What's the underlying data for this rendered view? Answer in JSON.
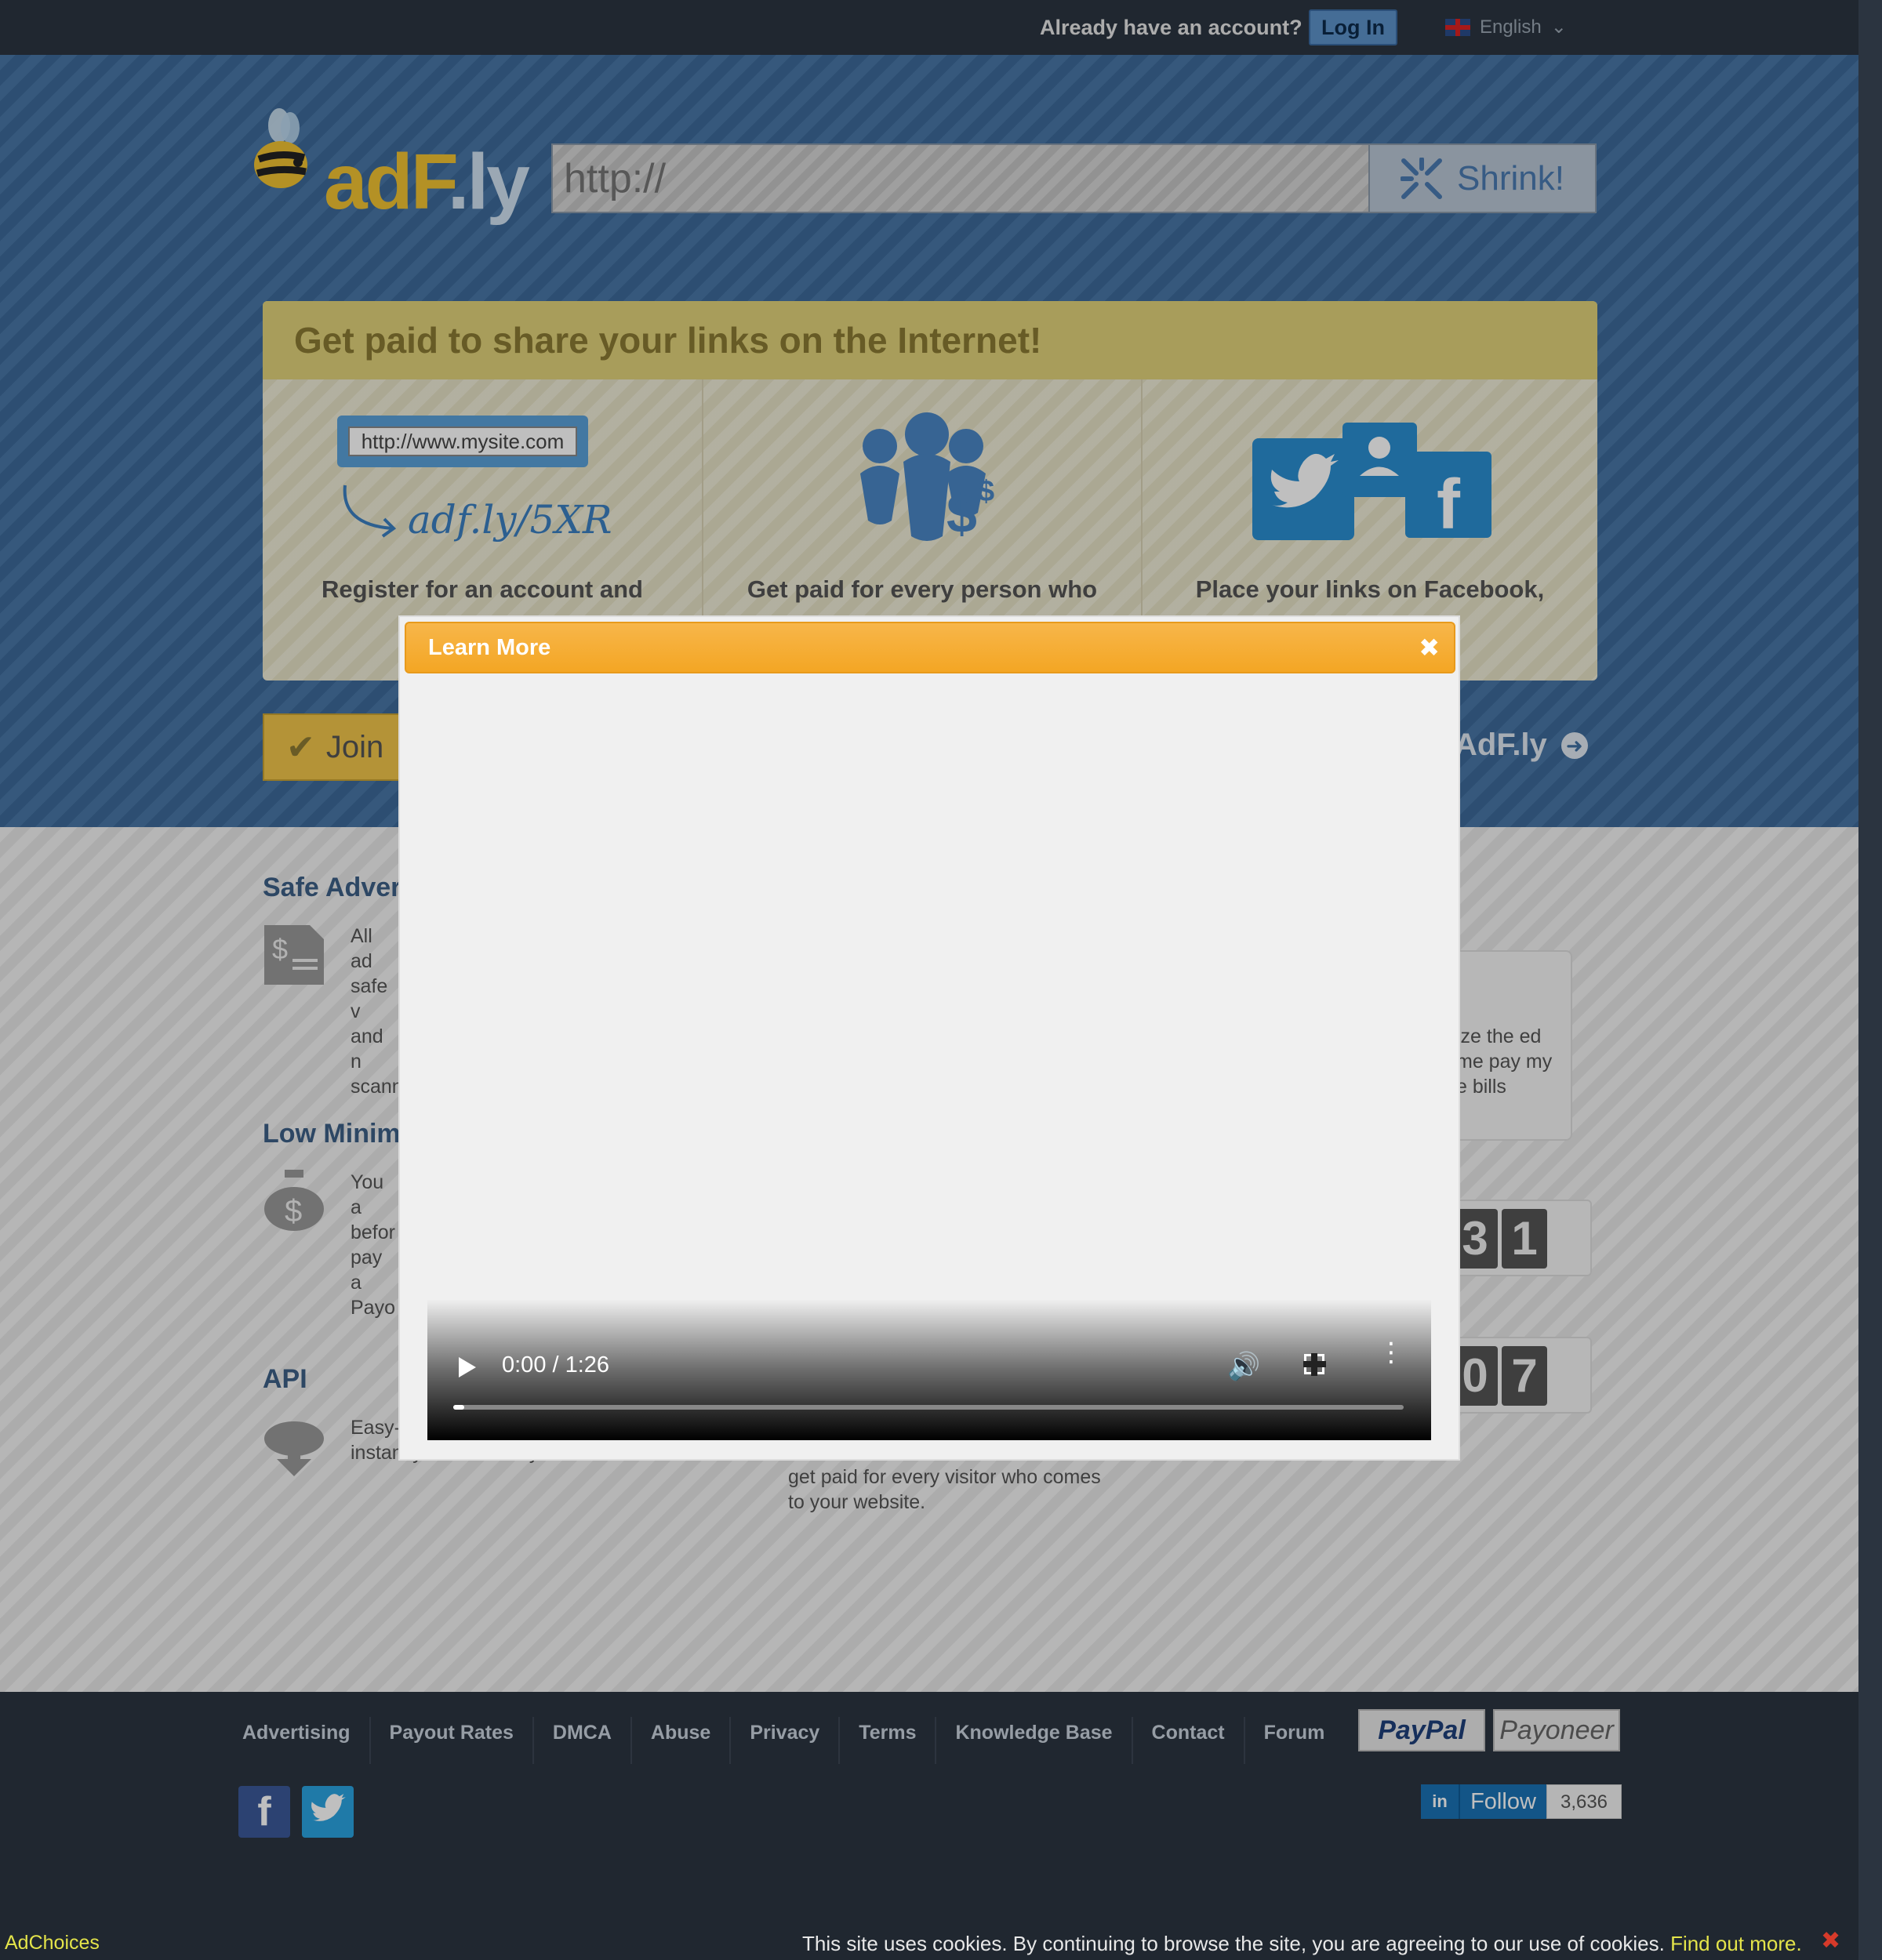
{
  "topbar": {
    "already_text": "Already have an account?",
    "login_label": "Log In",
    "language": "English"
  },
  "header": {
    "logo_main": "adF",
    "logo_suffix": ".ly",
    "url_placeholder": "http://",
    "shrink_label": "Shrink!"
  },
  "promo": {
    "title": "Get paid to share your links on the Internet!",
    "example_url": "http://www.mysite.com",
    "short_url": "adf.ly/5XR",
    "steps": [
      "Register for an account and",
      "Get paid for every person who",
      "Place your links on Facebook,"
    ]
  },
  "joinbar": {
    "join_label": "Join",
    "more_label": "AdF.ly"
  },
  "features": [
    {
      "title": "Safe Adver",
      "text": "All ad safe v and n scann"
    },
    {
      "title": "Low Minim",
      "text": "You a befor pay a Payo"
    },
    {
      "title": "API",
      "text": "Easy- webs an AdF.ly link instantly and securely."
    }
  ],
  "feature_extra_text": "get paid for every visitor who comes to your website.",
  "testimonial_text": "ize the ed me pay my e bills",
  "counters": [
    {
      "digits": [
        "3",
        "1"
      ]
    },
    {
      "digits": [
        "0",
        "7"
      ]
    }
  ],
  "footer": {
    "links": [
      "Advertising",
      "Payout Rates",
      "DMCA",
      "Abuse",
      "Privacy",
      "Terms",
      "Knowledge Base",
      "Contact",
      "Forum"
    ],
    "paypal": "PayPal",
    "payoneer": "Payoneer",
    "follow_label": "Follow",
    "follow_count": "3,636",
    "adchoices": "AdChoices",
    "cookie_text": "This site uses cookies. By continuing to browse the site, you are agreeing to our use of cookies.",
    "cookie_link": "Find out more.",
    "colors": {
      "accent": "#f4a624",
      "brand_blue": "#3f6fa1"
    }
  },
  "modal": {
    "title": "Learn More",
    "video_time": "0:00 / 1:26",
    "video_progress": 0.0
  }
}
